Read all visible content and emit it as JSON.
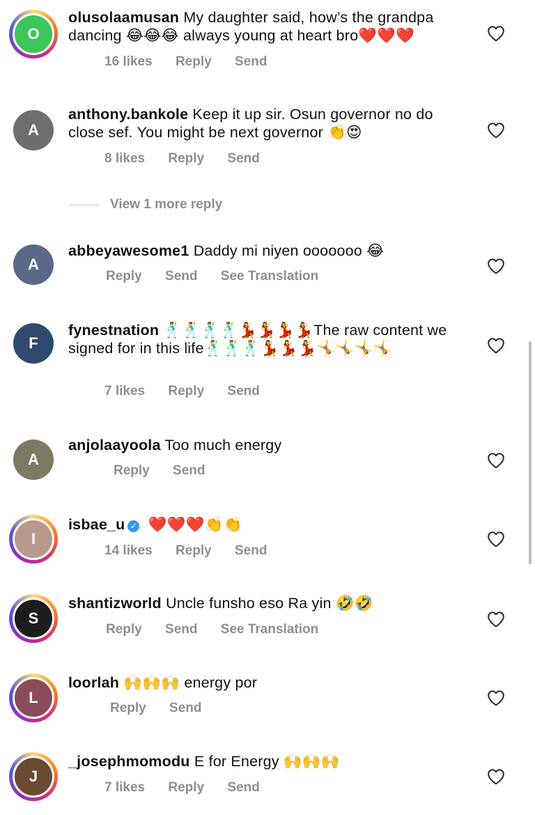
{
  "comments": [
    {
      "username": "olusolaamusan",
      "text": "My daughter said, how’s the grandpa dancing 😂😂😂 always young at heart bro❤️❤️❤️",
      "likes": "16 likes",
      "reply": "Reply",
      "send": "Send",
      "avatar_color": "#3cc65a",
      "avatar_initial": "O",
      "story_ring": true
    },
    {
      "username": "anthony.bankole",
      "text": "Keep it up sir. Osun governor no do close sef. You might be next governor 👏😍",
      "likes": "8 likes",
      "reply": "Reply",
      "send": "Send",
      "avatar_color": "#6e6e6e",
      "avatar_initial": "A",
      "story_ring": false
    },
    {
      "username": "abbeyawesome1",
      "text": "Daddy mi niyen ooooooo 😂",
      "reply": "Reply",
      "send": "Send",
      "see_translation": "See Translation",
      "avatar_color": "#5a6a86",
      "avatar_initial": "A",
      "story_ring": false
    },
    {
      "username": "fynestnation",
      "text": "🕺🕺🕺🕺💃💃💃💃The raw content we signed for in this life🕺🕺🕺💃💃💃🤸🤸🤸🤸",
      "likes": "7 likes",
      "reply": "Reply",
      "send": "Send",
      "avatar_color": "#2f4a6e",
      "avatar_initial": "F",
      "story_ring": false
    },
    {
      "username": "anjolaayoola",
      "text": "Too much energy",
      "reply": "Reply",
      "send": "Send",
      "avatar_color": "#7d7a62",
      "avatar_initial": "A",
      "story_ring": false
    },
    {
      "username": "isbae_u",
      "text": "❤️❤️❤️👏👏",
      "likes": "14 likes",
      "reply": "Reply",
      "send": "Send",
      "avatar_color": "#b89a8c",
      "avatar_initial": "I",
      "story_ring": true,
      "verified": true
    },
    {
      "username": "shantizworld",
      "text": "Uncle funsho eso Ra yin 🤣🤣",
      "reply": "Reply",
      "send": "Send",
      "see_translation": "See Translation",
      "avatar_color": "#1d1d1d",
      "avatar_initial": "S",
      "story_ring": true
    },
    {
      "username": "loorlah",
      "text": "🙌🙌🙌 energy por",
      "reply": "Reply",
      "send": "Send",
      "avatar_color": "#8a4b5a",
      "avatar_initial": "L",
      "story_ring": true
    },
    {
      "username": "_josephmomodu",
      "text": "E for Energy 🙌🙌🙌",
      "likes": "7 likes",
      "reply": "Reply",
      "send": "Send",
      "avatar_color": "#6b4a32",
      "avatar_initial": "J",
      "story_ring": true
    }
  ],
  "view_more_replies": "View 1 more reply",
  "icons": {
    "like": "heart-outline-icon",
    "verified": "verified-badge-icon"
  },
  "colors": {
    "meta_text": "#8e8e8e",
    "verified_badge": "#3897f0",
    "story_ring": [
      "#feda75",
      "#fa7e1e",
      "#d62976",
      "#962fbf",
      "#4f5bd5"
    ]
  }
}
